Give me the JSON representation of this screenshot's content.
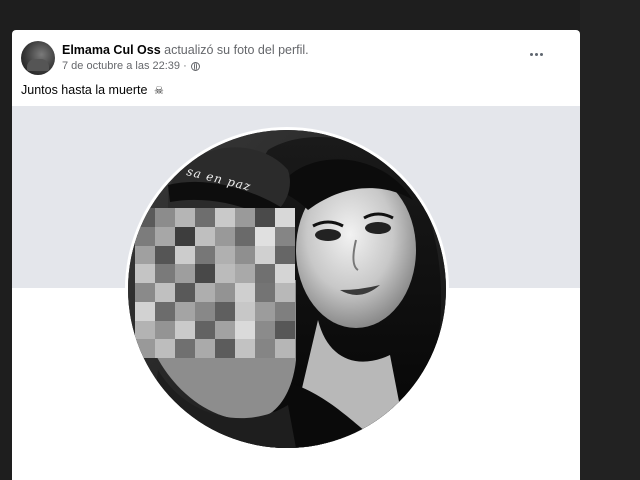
{
  "post": {
    "author": "Elmama Cul Oss",
    "action": " actualizó su foto del perfil.",
    "timestamp": "7 de octubre a las 22:39 ·",
    "privacy_icon": "globe-icon",
    "more_icon": "more-options-icon",
    "text": "Juntos hasta la muerte",
    "emoji": "☠"
  },
  "photo": {
    "headband_text": "sa en paz"
  },
  "colors": {
    "card_bg": "#ffffff",
    "cover_bg": "#e4e6eb",
    "secondary_text": "#65676b",
    "primary_text": "#050505",
    "page_bg": "#1e1e1e"
  }
}
